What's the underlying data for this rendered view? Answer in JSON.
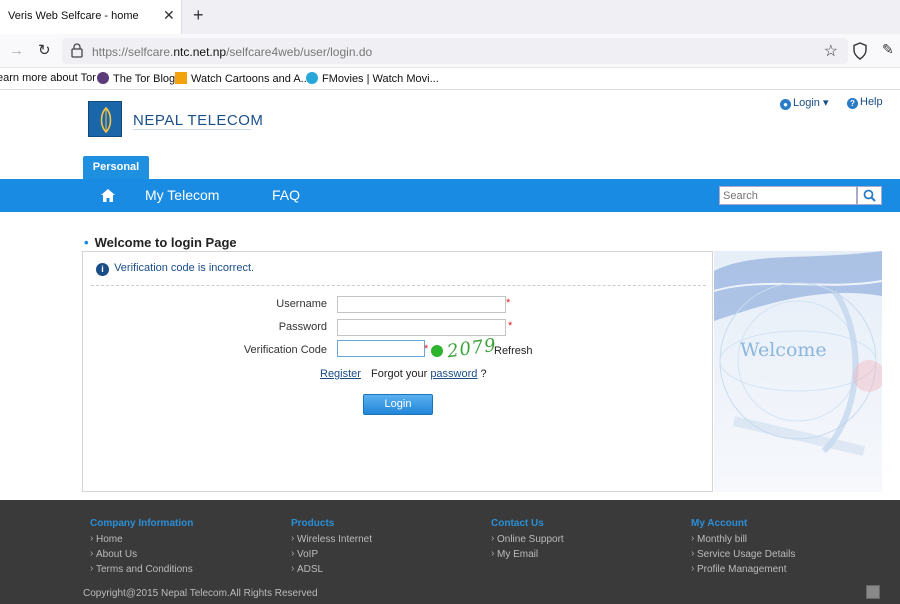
{
  "browser": {
    "tab_title": "Veris Web Selfcare - home",
    "tab_close": "✕",
    "new_tab": "+",
    "url_prefix": "https://selfcare.",
    "url_domain": "ntc.net.np",
    "url_path": "/selfcare4web/user/login.do",
    "bookmarks": [
      "earn more about Tor",
      "The Tor Blog",
      "Watch Cartoons and A...",
      "FMovies | Watch Movi..."
    ]
  },
  "header": {
    "brand": "NEPAL  TELECOM",
    "login_label": "Login",
    "help_label": "Help"
  },
  "nav": {
    "personal_tab": "Personal",
    "items": [
      "My Telecom",
      "FAQ"
    ],
    "search_placeholder": "Search"
  },
  "login": {
    "title": "Welcome to login Page",
    "error": "Verification code is incorrect.",
    "username_label": "Username",
    "password_label": "Password",
    "verification_label": "Verification Code",
    "required_mark": "*",
    "captcha": "2079",
    "refresh": "Refresh",
    "register": "Register",
    "forgot_prefix": "Forgot your",
    "forgot_link": "password",
    "forgot_suffix": " ?",
    "button": "Login",
    "banner_text": "Welcome"
  },
  "footer": {
    "columns": [
      {
        "title": "Company Information",
        "items": [
          "Home",
          "About Us",
          "Terms and Conditions"
        ]
      },
      {
        "title": "Products",
        "items": [
          "Wireless Internet",
          "VoIP",
          "ADSL"
        ]
      },
      {
        "title": "Contact Us",
        "items": [
          "Online Support",
          "My Email"
        ]
      },
      {
        "title": "My Account",
        "items": [
          "Monthly bill",
          "Service Usage Details",
          "Profile Management"
        ]
      }
    ],
    "copyright": "Copyright@2015 Nepal Telecom.All Rights Reserved"
  },
  "colors": {
    "accent": "#1a8be2",
    "footer_bg": "#3a3a3a"
  }
}
